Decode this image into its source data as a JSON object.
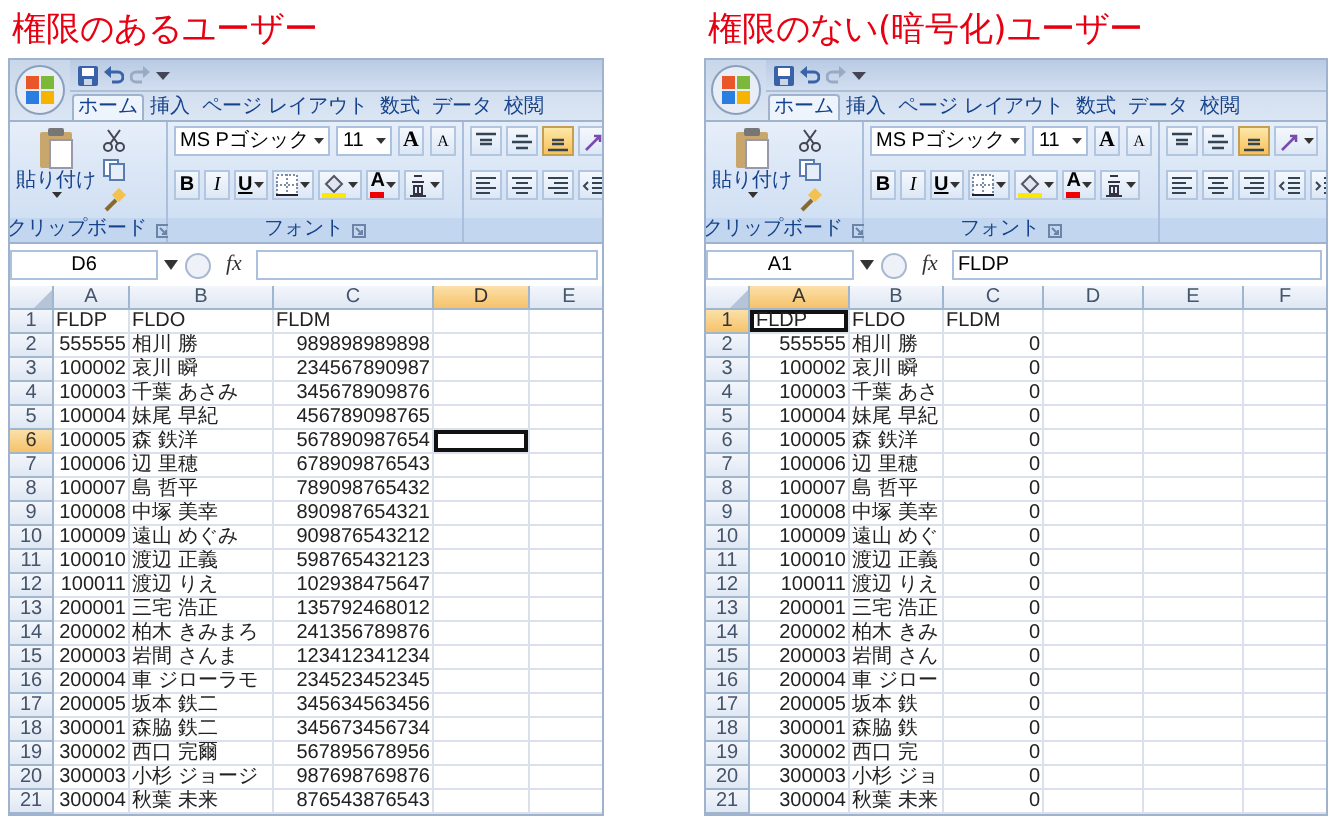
{
  "panels": [
    {
      "heading": "権限のあるユーザー",
      "tabs": [
        {
          "label": "ホーム",
          "selected": true
        },
        {
          "label": "挿入",
          "selected": false
        },
        {
          "label": "ページ レイアウト",
          "selected": false
        },
        {
          "label": "数式",
          "selected": false
        },
        {
          "label": "データ",
          "selected": false
        },
        {
          "label": "校閲",
          "selected": false
        }
      ],
      "clipboard": {
        "paste_label": "貼り付け",
        "group_label": "クリップボード"
      },
      "font": {
        "name": "MS Pゴシック",
        "size": "11",
        "grow": "A",
        "shrink": "A",
        "bold": "B",
        "italic": "I",
        "underline": "U",
        "font_color_label": "A",
        "group_label": "フォント"
      },
      "alignment": [
        {
          "kind": "top",
          "selected": false
        },
        {
          "kind": "middle",
          "selected": false
        },
        {
          "kind": "bottom",
          "selected": true
        },
        {
          "kind": "orientation",
          "selected": false
        },
        {
          "kind": "left",
          "selected": false
        },
        {
          "kind": "center",
          "selected": false
        },
        {
          "kind": "right",
          "selected": false
        },
        {
          "kind": "outdent",
          "selected": false
        }
      ],
      "formula_bar": {
        "name_box": "D6",
        "function_label": "fx"
      },
      "columns": [
        {
          "label": "A",
          "selected": false
        },
        {
          "label": "B",
          "selected": false
        },
        {
          "label": "C",
          "selected": false
        },
        {
          "label": "D",
          "selected": true
        },
        {
          "label": "E",
          "selected": false
        }
      ],
      "rows": [
        {
          "number": "1",
          "selected": false,
          "kind": "header",
          "cells": [
            "FLDP",
            "FLDO",
            "FLDM"
          ]
        },
        {
          "number": "2",
          "selected": false,
          "kind": "record",
          "cells": [
            "555555",
            "相川 勝",
            "989898989898"
          ]
        },
        {
          "number": "3",
          "selected": false,
          "kind": "record",
          "cells": [
            "100002",
            "哀川 瞬",
            "234567890987"
          ]
        },
        {
          "number": "4",
          "selected": false,
          "kind": "record",
          "cells": [
            "100003",
            "千葉 あさみ",
            "345678909876"
          ]
        },
        {
          "number": "5",
          "selected": false,
          "kind": "record",
          "cells": [
            "100004",
            "妹尾 早紀",
            "456789098765"
          ]
        },
        {
          "number": "6",
          "selected": true,
          "kind": "record",
          "cells": [
            "100005",
            "森 鉄洋",
            "567890987654"
          ]
        },
        {
          "number": "7",
          "selected": false,
          "kind": "record",
          "cells": [
            "100006",
            "辺 里穂",
            "678909876543"
          ]
        },
        {
          "number": "8",
          "selected": false,
          "kind": "record",
          "cells": [
            "100007",
            "島 哲平",
            "789098765432"
          ]
        },
        {
          "number": "9",
          "selected": false,
          "kind": "record",
          "cells": [
            "100008",
            "中塚 美幸",
            "890987654321"
          ]
        },
        {
          "number": "10",
          "selected": false,
          "kind": "record",
          "cells": [
            "100009",
            "遠山 めぐみ",
            "909876543212"
          ]
        },
        {
          "number": "11",
          "selected": false,
          "kind": "record",
          "cells": [
            "100010",
            "渡辺 正義",
            "598765432123"
          ]
        },
        {
          "number": "12",
          "selected": false,
          "kind": "record",
          "cells": [
            "100011",
            "渡辺 りえ",
            "102938475647"
          ]
        },
        {
          "number": "13",
          "selected": false,
          "kind": "record",
          "cells": [
            "200001",
            "三宅 浩正",
            "135792468012"
          ]
        },
        {
          "number": "14",
          "selected": false,
          "kind": "record",
          "cells": [
            "200002",
            "柏木 きみまろ",
            "241356789876"
          ]
        },
        {
          "number": "15",
          "selected": false,
          "kind": "record",
          "cells": [
            "200003",
            "岩間 さんま",
            "123412341234"
          ]
        },
        {
          "number": "16",
          "selected": false,
          "kind": "record",
          "cells": [
            "200004",
            "車 ジローラモ",
            "234523452345"
          ]
        },
        {
          "number": "17",
          "selected": false,
          "kind": "record",
          "cells": [
            "200005",
            "坂本 鉄二",
            "345634563456"
          ]
        },
        {
          "number": "18",
          "selected": false,
          "kind": "record",
          "cells": [
            "300001",
            "森脇 鉄二",
            "345673456734"
          ]
        },
        {
          "number": "19",
          "selected": false,
          "kind": "record",
          "cells": [
            "300002",
            "西口 完爾",
            "567895678956"
          ]
        },
        {
          "number": "20",
          "selected": false,
          "kind": "record",
          "cells": [
            "300003",
            "小杉 ジョージ",
            "987698769876"
          ]
        },
        {
          "number": "21",
          "selected": false,
          "kind": "record",
          "cells": [
            "300004",
            "秋葉 未来",
            "876543876543"
          ]
        }
      ]
    },
    {
      "heading": "権限のない(暗号化)ユーザー",
      "tabs": [
        {
          "label": "ホーム",
          "selected": true
        },
        {
          "label": "挿入",
          "selected": false
        },
        {
          "label": "ページ レイアウト",
          "selected": false
        },
        {
          "label": "数式",
          "selected": false
        },
        {
          "label": "データ",
          "selected": false
        },
        {
          "label": "校閲",
          "selected": false
        }
      ],
      "clipboard": {
        "paste_label": "貼り付け",
        "group_label": "クリップボード"
      },
      "font": {
        "name": "MS Pゴシック",
        "size": "11",
        "grow": "A",
        "shrink": "A",
        "bold": "B",
        "italic": "I",
        "underline": "U",
        "font_color_label": "A",
        "group_label": "フォント"
      },
      "alignment": [
        {
          "kind": "top",
          "selected": false
        },
        {
          "kind": "middle",
          "selected": false
        },
        {
          "kind": "bottom",
          "selected": true
        },
        {
          "kind": "orientation",
          "selected": false
        },
        {
          "kind": "left",
          "selected": false
        },
        {
          "kind": "center",
          "selected": false
        },
        {
          "kind": "right",
          "selected": false
        },
        {
          "kind": "outdent",
          "selected": false
        },
        {
          "kind": "indent",
          "selected": false
        }
      ],
      "formula_bar": {
        "name_box": "A1",
        "function_label": "fx",
        "value": "FLDP"
      },
      "columns": [
        {
          "label": "A",
          "selected": true
        },
        {
          "label": "B",
          "selected": false
        },
        {
          "label": "C",
          "selected": false
        },
        {
          "label": "D",
          "selected": false
        },
        {
          "label": "E",
          "selected": false
        },
        {
          "label": "F",
          "selected": false
        }
      ],
      "rows": [
        {
          "number": "1",
          "selected": true,
          "kind": "header",
          "cells": [
            "FLDP",
            "FLDO",
            "FLDM"
          ]
        },
        {
          "number": "2",
          "selected": false,
          "kind": "record",
          "cells": [
            "555555",
            "相川 勝",
            "0"
          ]
        },
        {
          "number": "3",
          "selected": false,
          "kind": "record",
          "cells": [
            "100002",
            "哀川 瞬",
            "0"
          ]
        },
        {
          "number": "4",
          "selected": false,
          "kind": "record",
          "cells": [
            "100003",
            "千葉 あさ",
            "0"
          ]
        },
        {
          "number": "5",
          "selected": false,
          "kind": "record",
          "cells": [
            "100004",
            "妹尾 早紀",
            "0"
          ]
        },
        {
          "number": "6",
          "selected": false,
          "kind": "record",
          "cells": [
            "100005",
            "森 鉄洋",
            "0"
          ]
        },
        {
          "number": "7",
          "selected": false,
          "kind": "record",
          "cells": [
            "100006",
            "辺 里穂",
            "0"
          ]
        },
        {
          "number": "8",
          "selected": false,
          "kind": "record",
          "cells": [
            "100007",
            "島 哲平",
            "0"
          ]
        },
        {
          "number": "9",
          "selected": false,
          "kind": "record",
          "cells": [
            "100008",
            "中塚 美幸",
            "0"
          ]
        },
        {
          "number": "10",
          "selected": false,
          "kind": "record",
          "cells": [
            "100009",
            "遠山 めぐ",
            "0"
          ]
        },
        {
          "number": "11",
          "selected": false,
          "kind": "record",
          "cells": [
            "100010",
            "渡辺 正義",
            "0"
          ]
        },
        {
          "number": "12",
          "selected": false,
          "kind": "record",
          "cells": [
            "100011",
            "渡辺 りえ",
            "0"
          ]
        },
        {
          "number": "13",
          "selected": false,
          "kind": "record",
          "cells": [
            "200001",
            "三宅 浩正",
            "0"
          ]
        },
        {
          "number": "14",
          "selected": false,
          "kind": "record",
          "cells": [
            "200002",
            "柏木 きみ",
            "0"
          ]
        },
        {
          "number": "15",
          "selected": false,
          "kind": "record",
          "cells": [
            "200003",
            "岩間 さん",
            "0"
          ]
        },
        {
          "number": "16",
          "selected": false,
          "kind": "record",
          "cells": [
            "200004",
            "車 ジロー",
            "0"
          ]
        },
        {
          "number": "17",
          "selected": false,
          "kind": "record",
          "cells": [
            "200005",
            "坂本 鉄",
            "0"
          ]
        },
        {
          "number": "18",
          "selected": false,
          "kind": "record",
          "cells": [
            "300001",
            "森脇 鉄",
            "0"
          ]
        },
        {
          "number": "19",
          "selected": false,
          "kind": "record",
          "cells": [
            "300002",
            "西口 完",
            "0"
          ]
        },
        {
          "number": "20",
          "selected": false,
          "kind": "record",
          "cells": [
            "300003",
            "小杉 ジョ",
            "0"
          ]
        },
        {
          "number": "21",
          "selected": false,
          "kind": "record",
          "cells": [
            "300004",
            "秋葉 未来",
            "0"
          ]
        }
      ]
    }
  ]
}
